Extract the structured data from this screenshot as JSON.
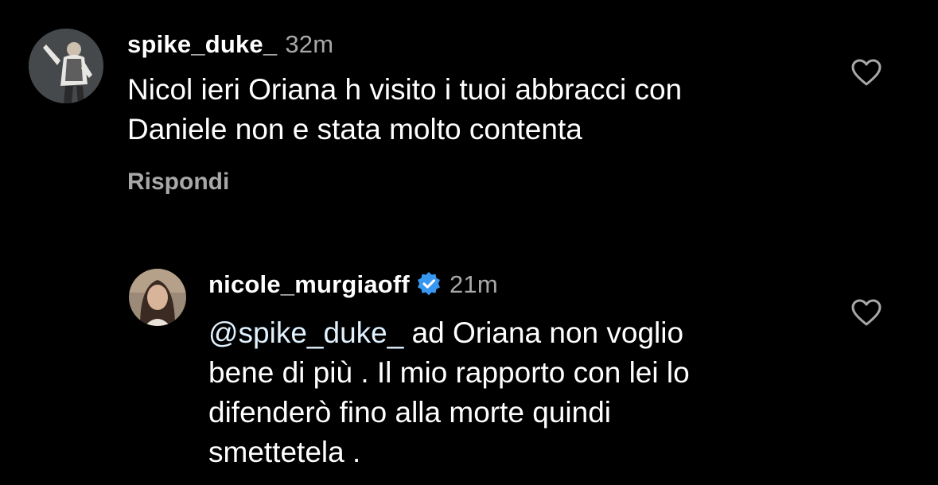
{
  "comments": [
    {
      "username": "spike_duke_",
      "time": "32m",
      "lines": [
        "Nicol ieri Oriana h visito i tuoi abbracci con",
        "Daniele non e stata molto contenta"
      ],
      "reply_label": "Rispondi"
    },
    {
      "username": "nicole_murgiaoff",
      "verified": true,
      "time": "21m",
      "mention": "@spike_duke_",
      "lines": [
        " ad Oriana non voglio",
        "bene di più . Il mio rapporto con lei lo",
        "difenderò fino alla morte quindi",
        "smettetela ."
      ]
    }
  ],
  "colors": {
    "background": "#000000",
    "text": "#ffffff",
    "secondary": "#a8a8a8",
    "verified": "#3897f0"
  },
  "icons": [
    "heart-icon",
    "verified-badge-icon"
  ]
}
